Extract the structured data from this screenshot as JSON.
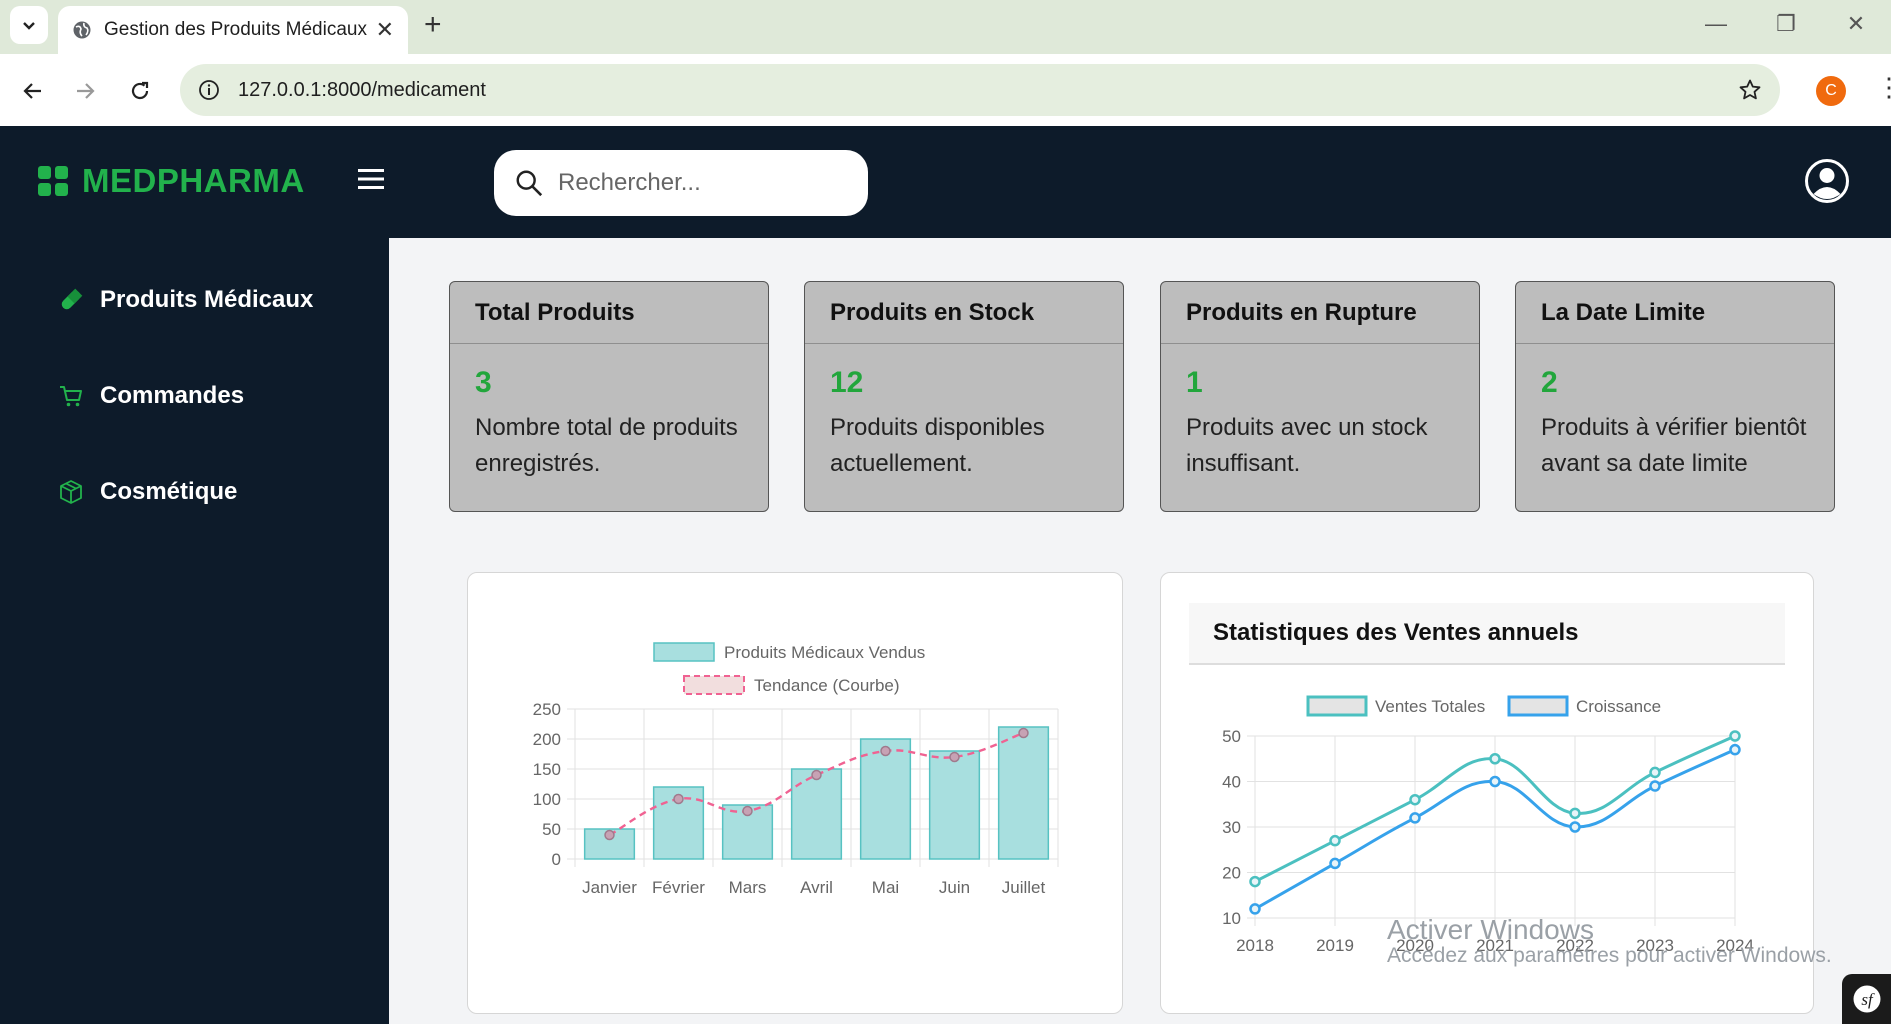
{
  "browser": {
    "tab_title": "Gestion des Produits Médicaux",
    "tab_close": "✕",
    "new_tab": "+",
    "url": "127.0.0.1:8000/medicament",
    "profile_initial": "C"
  },
  "app": {
    "brand": "MEDPHARMA",
    "brand_color": "#22b24c",
    "dark_bg": "#0d1b2a",
    "search_placeholder": "Rechercher..."
  },
  "sidebar": {
    "items": [
      {
        "label": "Produits Médicaux",
        "icon": "capsule-icon"
      },
      {
        "label": "Commandes",
        "icon": "cart-icon"
      },
      {
        "label": "Cosmétique",
        "icon": "box-icon"
      }
    ]
  },
  "cards": [
    {
      "title": "Total Produits",
      "value": "3",
      "text1": "Nombre total de produits",
      "text2": "enregistrés."
    },
    {
      "title": "Produits en Stock",
      "value": "12",
      "text1": "Produits disponibles",
      "text2": "actuellement."
    },
    {
      "title": "Produits en Rupture",
      "value": "1",
      "text1": "Produits avec un stock",
      "text2": "insuffisant."
    },
    {
      "title": "La Date Limite",
      "value": "2",
      "text1": "Produits à vérifier bientôt",
      "text2": "avant sa date limite"
    }
  ],
  "chart_data": [
    {
      "type": "bar",
      "title": "",
      "categories": [
        "Janvier",
        "Février",
        "Mars",
        "Avril",
        "Mai",
        "Juin",
        "Juillet"
      ],
      "series": [
        {
          "name": "Produits Médicaux Vendus",
          "type": "bar",
          "values": [
            50,
            120,
            90,
            150,
            200,
            180,
            220
          ],
          "color": "#a8dfdf",
          "border": "#57c2c2"
        },
        {
          "name": "Tendance (Courbe)",
          "type": "line",
          "style": "dashed",
          "values": [
            40,
            100,
            80,
            140,
            180,
            170,
            210
          ],
          "color": "#f06292"
        }
      ],
      "ylim": [
        0,
        250
      ],
      "yticks": [
        0,
        50,
        100,
        150,
        200,
        250
      ],
      "grid": true,
      "legend": "top"
    },
    {
      "type": "line",
      "title": "Statistiques des Ventes annuels",
      "x": [
        "2018",
        "2019",
        "2020",
        "2021",
        "2022",
        "2023",
        "2024"
      ],
      "series": [
        {
          "name": "Ventes Totales",
          "values": [
            18,
            27,
            36,
            45,
            33,
            42,
            50
          ],
          "color": "#4bc0c0"
        },
        {
          "name": "Croissance",
          "values": [
            12,
            22,
            32,
            40,
            30,
            39,
            47
          ],
          "color": "#36a2eb"
        }
      ],
      "ylim": [
        10,
        50
      ],
      "yticks": [
        10,
        20,
        30,
        40,
        50
      ],
      "grid": true,
      "legend": "top"
    }
  ],
  "watermark": {
    "line1": "Activer Windows",
    "line2": "Accédez aux paramètres pour activer Windows."
  }
}
